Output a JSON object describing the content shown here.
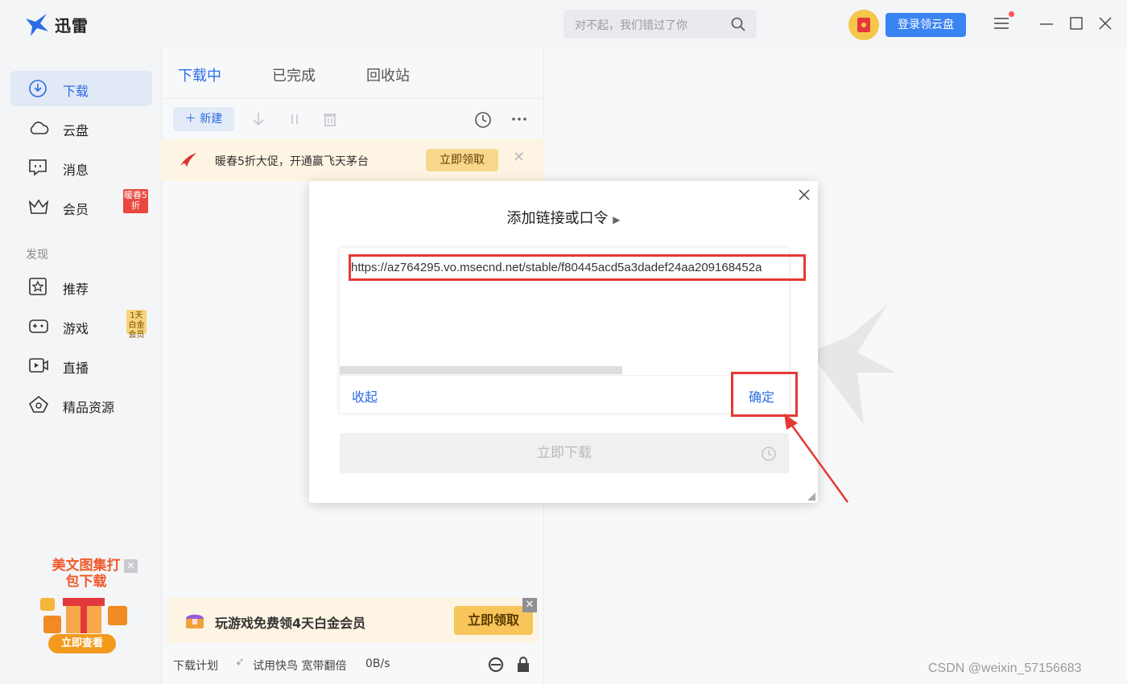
{
  "app": {
    "name": "迅雷",
    "search_placeholder": "对不起，我们错过了你",
    "login_button": "登录领云盘"
  },
  "sidebar": {
    "items": [
      {
        "label": "下载"
      },
      {
        "label": "云盘"
      },
      {
        "label": "消息"
      },
      {
        "label": "会员",
        "badge": "暖春5折"
      }
    ],
    "discover_label": "发现",
    "discover_items": [
      {
        "label": "推荐"
      },
      {
        "label": "游戏",
        "badge": "1天白金会员"
      },
      {
        "label": "直播"
      },
      {
        "label": "精品资源"
      }
    ],
    "promo": {
      "title": "美文图集打包下载",
      "button": "立即查看"
    }
  },
  "downloads": {
    "tabs": [
      "下载中",
      "已完成",
      "回收站"
    ],
    "new_button": "新建",
    "ad": {
      "text": "暖春5折大促，开通赢飞天茅台",
      "button": "立即领取"
    },
    "bottom_ad": {
      "text": "玩游戏免费领4天白金会员",
      "button": "立即领取"
    },
    "status": {
      "plan": "下载计划",
      "trial": "试用快鸟 宽带翻倍",
      "speed": "0B/s"
    }
  },
  "dialog": {
    "title": "添加链接或口令",
    "url": "https://az764295.vo.msecnd.net/stable/f80445acd5a3dadef24aa209168452a",
    "collapse": "收起",
    "confirm": "确定",
    "download_now": "立即下载"
  },
  "watermark": "CSDN @weixin_57156683",
  "colors": {
    "accent": "#2b6de5",
    "highlight": "#e53935",
    "login": "#3a83f3"
  }
}
